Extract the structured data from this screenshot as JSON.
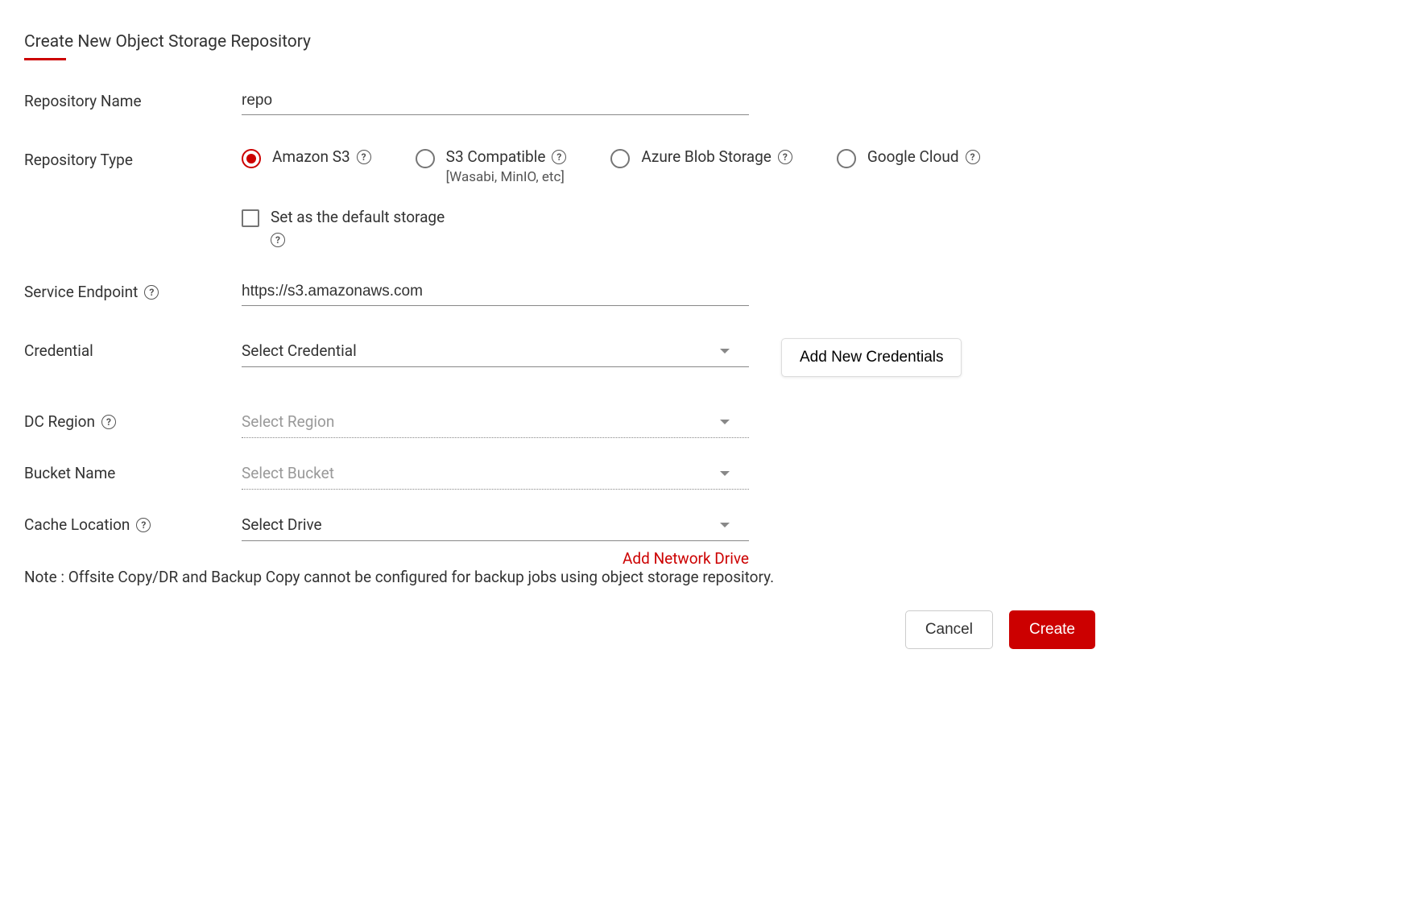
{
  "title": "Create New Object Storage Repository",
  "labels": {
    "name": "Repository Name",
    "type": "Repository Type",
    "endpoint": "Service Endpoint",
    "credential": "Credential",
    "region": "DC Region",
    "bucket": "Bucket Name",
    "cache": "Cache Location"
  },
  "fields": {
    "name_value": "repo",
    "endpoint_value": "https://s3.amazonaws.com",
    "credential_value": "Select Credential",
    "region_value": "Select Region",
    "bucket_value": "Select Bucket",
    "cache_value": "Select Drive"
  },
  "types": {
    "s3": "Amazon S3",
    "s3compat": "S3 Compatible",
    "s3compat_sub": "[Wasabi, MinIO, etc]",
    "azure": "Azure Blob Storage",
    "google": "Google Cloud"
  },
  "checkbox": {
    "default_storage": "Set as the default storage"
  },
  "buttons": {
    "add_credentials": "Add New Credentials",
    "add_network_drive": "Add Network Drive",
    "cancel": "Cancel",
    "create": "Create"
  },
  "note": "Note : Offsite Copy/DR and Backup Copy cannot be configured for backup jobs using object storage repository.",
  "help": "?"
}
